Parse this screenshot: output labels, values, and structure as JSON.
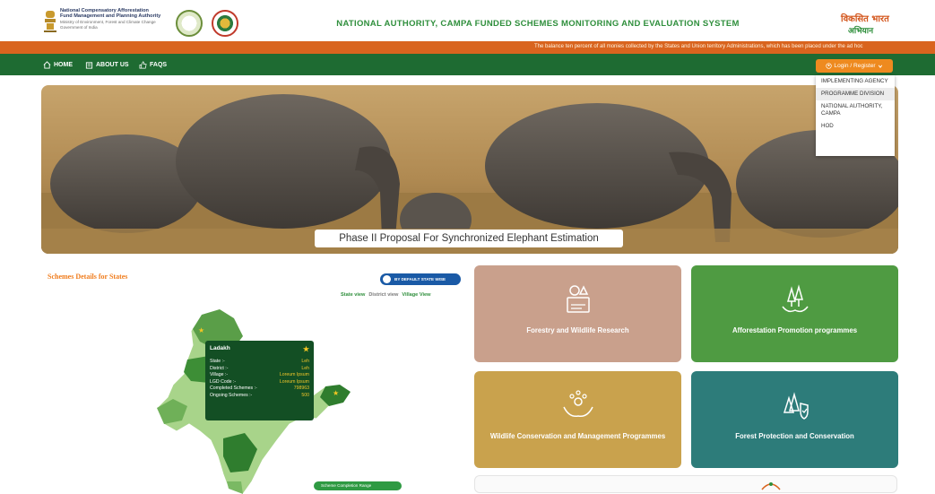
{
  "header": {
    "org_lines": [
      "National Compensatory Afforestation",
      "Fund Management and Planning Authority",
      "Ministry of Environment, Forest and Climate Change",
      "Government of India"
    ],
    "site_title": "NATIONAL AUTHORITY, CAMPA FUNDED SCHEMES MONITORING AND EVALUATION SYSTEM",
    "viksit_line1": "विकसित भारत",
    "viksit_line2": "अभियान"
  },
  "ticker": {
    "text": "The balance ten percent of all monies collected by the States and Union territory Administrations, which has been placed under the ad hoc"
  },
  "nav": {
    "home": "HOME",
    "about": "ABOUT US",
    "faqs": "FAQS",
    "login": "Login / Register"
  },
  "dropdown": {
    "items": [
      "IMPLEMENTING AGENCY",
      "PROGRAMME DIVISION",
      "NATIONAL AUTHORITY, CAMPA",
      "HOD"
    ],
    "hovered": "PROGRAMME DIVISION"
  },
  "banner": {
    "caption": "Phase II Proposal For Synchronized Elephant Estimation"
  },
  "schemes": {
    "title": "Schemes Details for States",
    "toggle_label": "BY DEFAULT STATE WISE",
    "view_state": "State view",
    "view_district": "District view",
    "view_village": "Village View",
    "legend_label": "Scheme Completion Range"
  },
  "tooltip": {
    "name": "Ladakh",
    "rows": [
      {
        "label": "State :-",
        "value": "Leh"
      },
      {
        "label": "District :-",
        "value": "Leh"
      },
      {
        "label": "Village :-",
        "value": "Loreum Ipsum"
      },
      {
        "label": "LGD Code :-",
        "value": "Loreum Ipsum"
      },
      {
        "label": "Completed Schemes :-",
        "value": "798963"
      },
      {
        "label": "Ongoing Schemes :-",
        "value": "500"
      }
    ]
  },
  "cards": [
    {
      "label": "Forestry and Wildlife Research",
      "icon": "research-lab-icon",
      "color": "#c9a08c"
    },
    {
      "label": "Afforestation Promotion programmes",
      "icon": "trees-hands-icon",
      "color": "#4f9b42"
    },
    {
      "label": "Wildlife Conservation and Management Programmes",
      "icon": "paw-hands-icon",
      "color": "#c9a24d"
    },
    {
      "label": "Forest Protection and Conservation",
      "icon": "forest-shield-icon",
      "color": "#2d7c7a"
    }
  ],
  "colors": {
    "nav_green": "#1e6b32",
    "ticker_orange": "#d9641e",
    "title_green": "#2f8f3c",
    "accent_orange": "#ee8a1f",
    "tooltip_green": "#134f24"
  }
}
